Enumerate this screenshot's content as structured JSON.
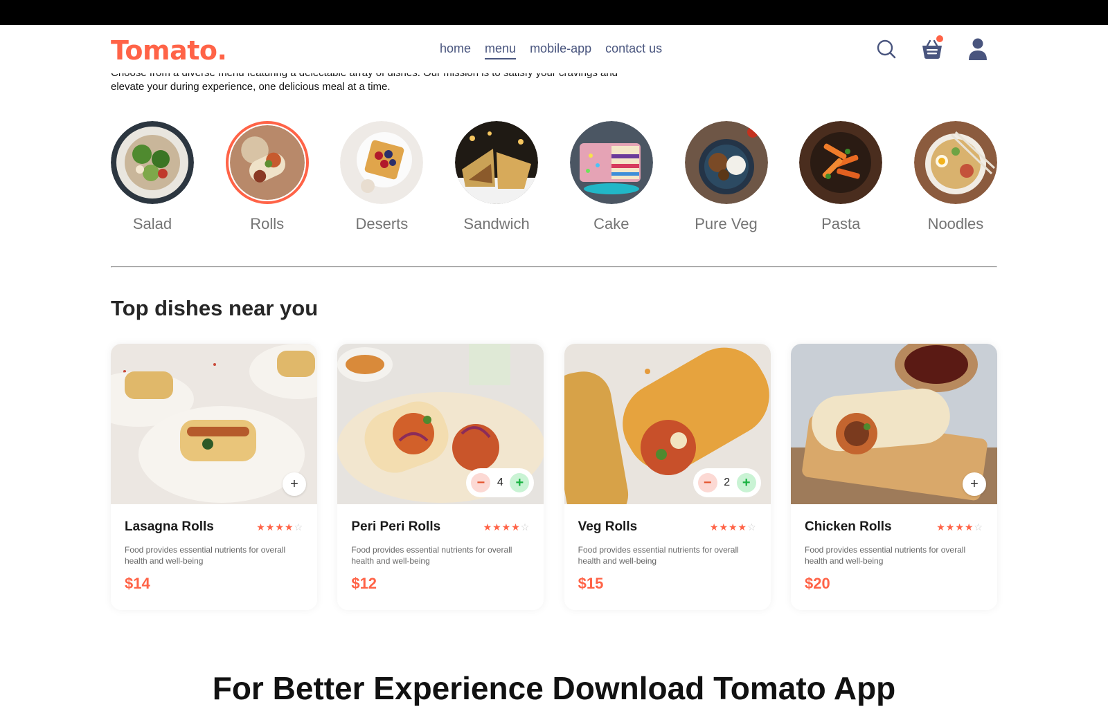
{
  "nav": {
    "logo": "Tomato.",
    "links": [
      "home",
      "menu",
      "mobile-app",
      "contact us"
    ],
    "active_link": "menu",
    "accent_color": "#ff6347"
  },
  "intro": {
    "text": "Choose from a diverse menu featuring a delectable array of dishes. Our mission is to satisfy your cravings and elevate your during experience, one delicious meal at a time."
  },
  "categories": [
    {
      "label": "Salad"
    },
    {
      "label": "Rolls"
    },
    {
      "label": "Deserts"
    },
    {
      "label": "Sandwich"
    },
    {
      "label": "Cake"
    },
    {
      "label": "Pure Veg"
    },
    {
      "label": "Pasta"
    },
    {
      "label": "Noodles"
    }
  ],
  "selected_category": "Rolls",
  "top_dishes": {
    "title": "Top dishes near you",
    "items": [
      {
        "name": "Lasagna Rolls",
        "rating": 4,
        "description": "Food provides essential nutrients for overall health and well-being",
        "price": "$14",
        "quantity": 0
      },
      {
        "name": "Peri Peri Rolls",
        "rating": 4,
        "description": "Food provides essential nutrients for overall health and well-being",
        "price": "$12",
        "quantity": 4
      },
      {
        "name": "Veg Rolls",
        "rating": 4,
        "description": "Food provides essential nutrients for overall health and well-being",
        "price": "$15",
        "quantity": 2
      },
      {
        "name": "Chicken Rolls",
        "rating": 4,
        "description": "Food provides essential nutrients for overall health and well-being",
        "price": "$20",
        "quantity": 0
      }
    ]
  },
  "app_download": {
    "title": "For Better Experience Download Tomato App"
  },
  "icons": {
    "search": "search-icon",
    "basket": "basket-icon",
    "profile": "profile-icon",
    "add": "plus-icon",
    "remove": "minus-icon"
  }
}
